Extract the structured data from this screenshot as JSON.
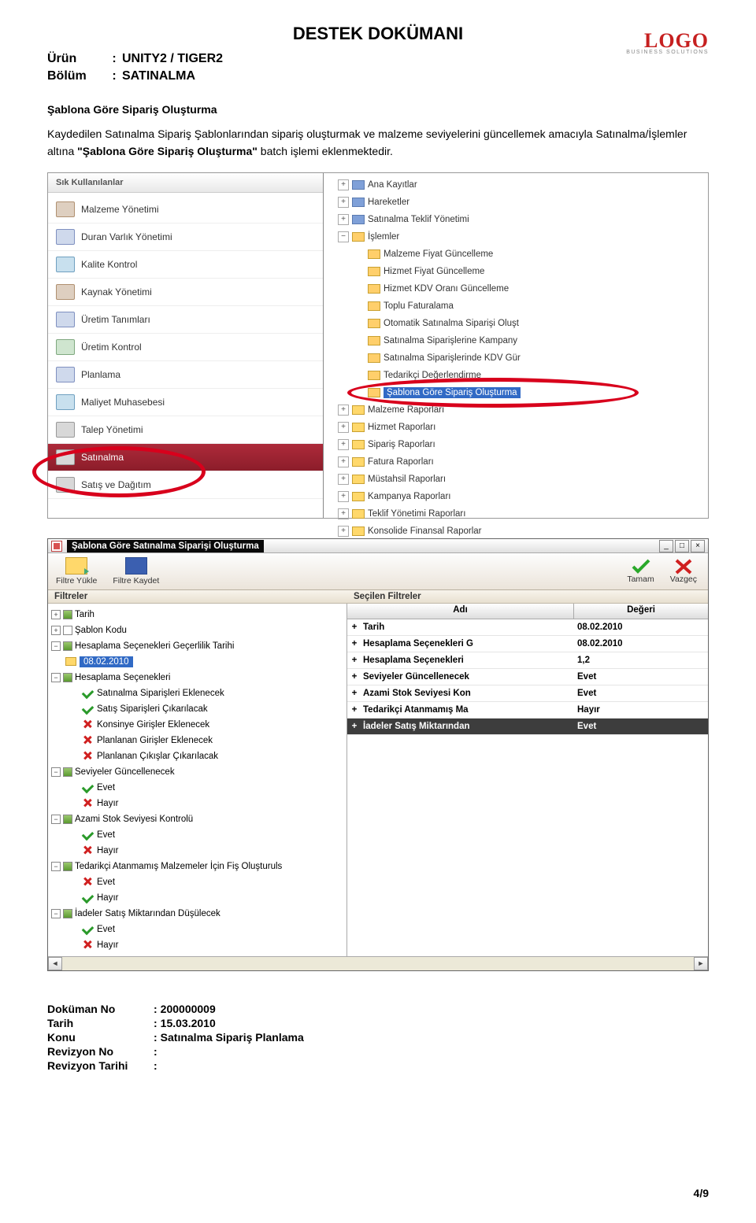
{
  "doc": {
    "title": "DESTEK DOKÜMANI",
    "product_label": "Ürün",
    "product_value": "UNITY2  / TIGER2",
    "section_label": "Bölüm",
    "section_value": "SATINALMA"
  },
  "logo": {
    "main": "LOGO",
    "sub": "BUSINESS SOLUTIONS"
  },
  "section_title": "Şablona Göre Sipariş Oluşturma",
  "body": {
    "pre": "Kaydedilen Satınalma Sipariş Şablonlarından sipariş oluşturmak ve malzeme seviyelerini güncellemek amacıyla Satınalma/İşlemler altına ",
    "bold": "\"Şablona Göre Sipariş Oluşturma\"",
    "post": " batch işlemi eklenmektedir."
  },
  "shot1": {
    "left_header": "Sık Kullanılanlar",
    "nav": [
      "Malzeme Yönetimi",
      "Duran Varlık Yönetimi",
      "Kalite Kontrol",
      "Kaynak Yönetimi",
      "Üretim Tanımları",
      "Üretim Kontrol",
      "Planlama",
      "Maliyet Muhasebesi",
      "Talep Yönetimi",
      "Satınalma",
      "Satış ve Dağıtım"
    ],
    "tree_top": [
      "Ana Kayıtlar",
      "Hareketler",
      "Satınalma Teklif Yönetimi",
      "İşlemler"
    ],
    "tree_ops": [
      "Malzeme Fiyat Güncelleme",
      "Hizmet Fiyat Güncelleme",
      "Hizmet KDV Oranı Güncelleme",
      "Toplu Faturalama",
      "Otomatik Satınalma Siparişi Oluşt",
      "Satınalma Siparişlerine Kampany",
      "Satınalma Siparişlerinde KDV Gür",
      "Tedarikçi Değerlendirme"
    ],
    "tree_sel": "Şablona Göre Sipariş Oluşturma",
    "tree_bottom": [
      "Malzeme Raporları",
      "Hizmet Raporları",
      "Sipariş Raporları",
      "Fatura Raporları",
      "Müstahsil Raporları",
      "Kampanya Raporları",
      "Teklif Yönetimi Raporları",
      "Konsolide Finansal Raporlar"
    ]
  },
  "shot2": {
    "title": "Şablona Göre Satınalma Siparişi Oluşturma",
    "toolbar": {
      "load": "Filtre Yükle",
      "save": "Filtre Kaydet",
      "ok": "Tamam",
      "cancel": "Vazgeç"
    },
    "section_left": "Filtreler",
    "section_right": "Seçilen Filtreler",
    "right_header": {
      "name": "Adı",
      "value": "Değeri"
    },
    "left_tree": {
      "tarih": "Tarih",
      "sablon": "Şablon Kodu",
      "hesap_gecer": "Hesaplama Seçenekleri Geçerlilik Tarihi",
      "date_sel": "08.02.2010",
      "hesap_sec": "Hesaplama Seçenekleri",
      "ops": [
        "Satınalma Siparişleri Eklenecek",
        "Satış Siparişleri Çıkarılacak",
        "Konsinye Girişler Eklenecek",
        "Planlanan Girişler Eklenecek",
        "Planlanan Çıkışlar Çıkarılacak"
      ],
      "ops_marks": [
        "g",
        "g",
        "r",
        "r",
        "r"
      ],
      "seviye": "Seviyeler Güncellenecek",
      "evet": "Evet",
      "hayir": "Hayır",
      "azami": "Azami Stok Seviyesi Kontrolü",
      "tedarik": "Tedarikçi Atanmamış Malzemeler İçin Fiş Oluşturuls",
      "iade": "İadeler Satış Miktarından Düşülecek"
    },
    "right_rows": [
      {
        "name": "Tarih",
        "value": "08.02.2010"
      },
      {
        "name": "Hesaplama Seçenekleri G",
        "value": "08.02.2010"
      },
      {
        "name": "Hesaplama Seçenekleri",
        "value": "1,2"
      },
      {
        "name": "Seviyeler Güncellenecek",
        "value": "Evet"
      },
      {
        "name": "Azami Stok Seviyesi Kon",
        "value": "Evet"
      },
      {
        "name": "Tedarikçi Atanmamış Ma",
        "value": "Hayır"
      },
      {
        "name": "İadeler Satış Miktarından",
        "value": "Evet"
      }
    ]
  },
  "footer": {
    "dokuman_no_label": "Doküman No",
    "dokuman_no": "200000009",
    "tarih_label": "Tarih",
    "tarih": "15.03.2010",
    "konu_label": "Konu",
    "konu": "Satınalma Sipariş Planlama",
    "rev_no_label": "Revizyon No",
    "rev_no": "",
    "rev_tarih_label": "Revizyon Tarihi",
    "rev_tarih": "",
    "page_num": "4/9"
  }
}
